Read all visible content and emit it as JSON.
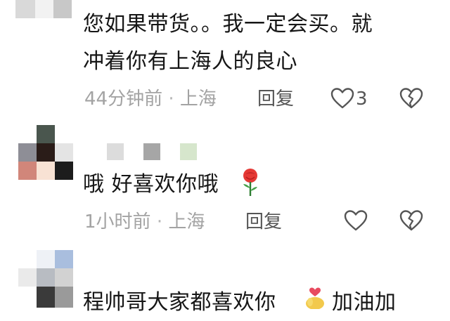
{
  "comments": [
    {
      "text_line1": "您如果带货。。我一定会买。就",
      "text_line2": "冲着你有上海人的良心",
      "time": "44分钟前",
      "separator": "·",
      "location": "上海",
      "reply_label": "回复",
      "like_count": "3",
      "like_icon": "heart-outline-icon",
      "dislike_icon": "broken-heart-icon"
    },
    {
      "text": "哦 好喜欢你哦",
      "emoji": "rose-icon",
      "time": "1小时前",
      "separator": "·",
      "location": "上海",
      "reply_label": "回复",
      "like_icon": "heart-outline-icon",
      "dislike_icon": "broken-heart-icon"
    },
    {
      "text_start": "程帅哥大家都喜欢你",
      "emoji": "heart-sticker-icon",
      "text_end": "加油加"
    }
  ],
  "colors": {
    "text": "#161616",
    "meta": "#a3a3a3",
    "icon": "#555555",
    "rose": "#e53935"
  }
}
